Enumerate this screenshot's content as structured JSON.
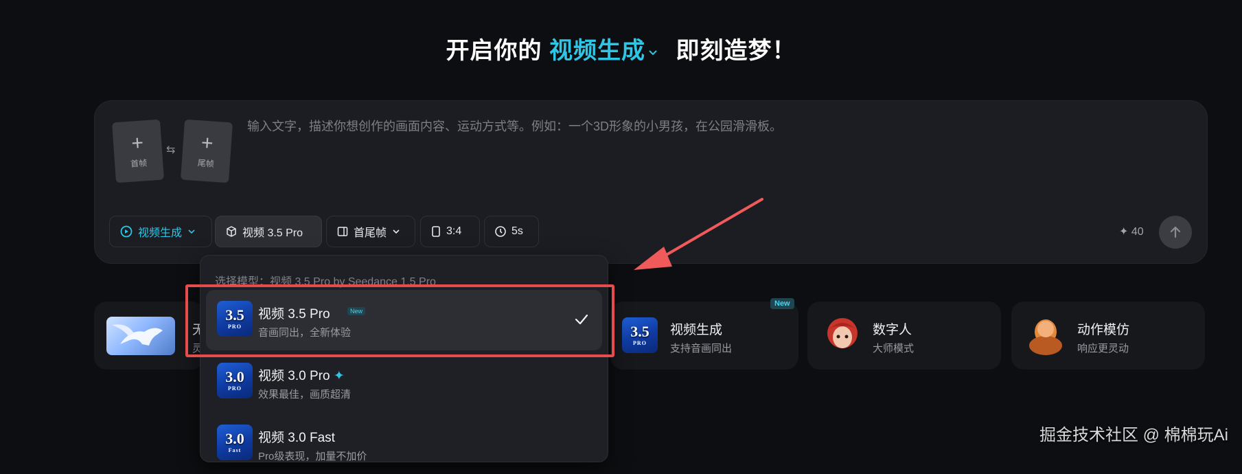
{
  "headline": {
    "prefix": "开启你的",
    "mode": "视频生成",
    "suffix": "即刻造梦！"
  },
  "composer": {
    "first_frame_label": "首帧",
    "last_frame_label": "尾帧",
    "prompt_placeholder": "输入文字，描述你想创作的画面内容、运动方式等。例如：一个3D形象的小男孩，在公园滑滑板。",
    "toolbar": {
      "mode": "视频生成",
      "model": "视频 3.5 Pro",
      "frame_mode": "首尾帧",
      "ratio": "3:4",
      "duration": "5s"
    },
    "credits": "40"
  },
  "dropdown": {
    "header": "选择模型：视频 3.5 Pro by Seedance 1.5 Pro",
    "items": [
      {
        "name": "视频 3.5 Pro",
        "badge": "New",
        "desc": "音画同出，全新体验",
        "thumb": "3.5",
        "thumb_tag": "PRO",
        "selected": true
      },
      {
        "name": "视频 3.0 Pro",
        "desc": "效果最佳，画质超清",
        "thumb": "3.0",
        "thumb_tag": "PRO"
      },
      {
        "name": "视频 3.0 Fast",
        "desc": "Pro级表现，加量不加价",
        "thumb": "3.0",
        "thumb_tag": "Fast"
      }
    ]
  },
  "cards": {
    "first": {
      "title": "无",
      "sub": "灵"
    },
    "video": {
      "badge": "New",
      "title": "视频生成",
      "sub": "支持音画同出",
      "thumb": "3.5",
      "thumb_tag": "PRO"
    },
    "digital": {
      "title": "数字人",
      "sub": "大师模式"
    },
    "motion": {
      "title": "动作模仿",
      "sub": "响应更灵动"
    }
  },
  "watermark": "掘金技术社区 @ 棉棉玩Ai",
  "colors": {
    "accent": "#2fc6e6",
    "highlight_box": "#e74c4c",
    "background": "#0d0e11"
  }
}
